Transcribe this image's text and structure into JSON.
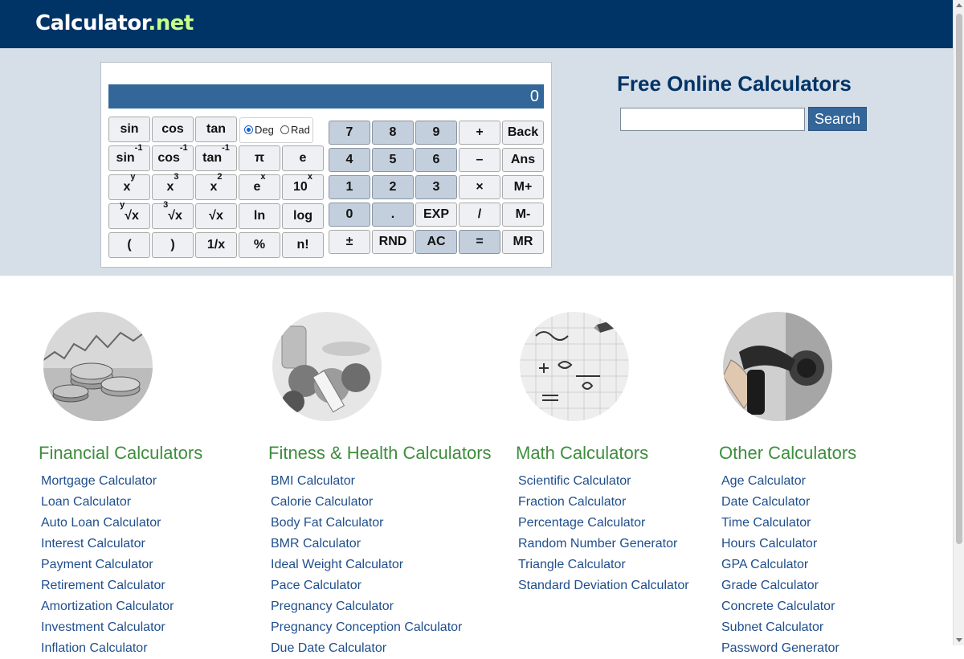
{
  "header": {
    "logo_part1": "Calculator",
    "logo_part2": ".",
    "logo_part3": "net"
  },
  "calculator": {
    "display_value": "0",
    "angle": {
      "deg_label": "Deg",
      "rad_label": "Rad",
      "selected": "Deg"
    },
    "fn_buttons": {
      "sin": "sin",
      "cos": "cos",
      "tan": "tan",
      "asin_base": "sin",
      "acos_base": "cos",
      "atan_base": "tan",
      "inverse_sup": "-1",
      "pi": "π",
      "e": "e",
      "xy_base": "x",
      "xy_sup": "y",
      "x3_base": "x",
      "x3_sup": "3",
      "x2_base": "x",
      "x2_sup": "2",
      "ex_base": "e",
      "ex_sup": "x",
      "tenx_base": "10",
      "tenx_sup": "x",
      "yroot_pre": "y",
      "yroot_base": "√x",
      "croot_pre": "3",
      "croot_base": "√x",
      "sqrt": "√x",
      "ln": "ln",
      "log": "log",
      "lparen": "(",
      "rparen": ")",
      "recip": "1/x",
      "percent": "%",
      "fact": "n!"
    },
    "keypad": {
      "n7": "7",
      "n8": "8",
      "n9": "9",
      "plus": "+",
      "back": "Back",
      "n4": "4",
      "n5": "5",
      "n6": "6",
      "minus": "–",
      "ans": "Ans",
      "n1": "1",
      "n2": "2",
      "n3": "3",
      "times": "×",
      "mplus": "M+",
      "n0": "0",
      "dot": ".",
      "exp": "EXP",
      "divide": "/",
      "mminus": "M-",
      "plusminus": "±",
      "rnd": "RND",
      "ac": "AC",
      "equals": "=",
      "mr": "MR"
    }
  },
  "search": {
    "title": "Free Online Calculators",
    "input_value": "",
    "button_label": "Search"
  },
  "categories": [
    {
      "title": "Financial Calculators",
      "image_icon": "coins-chart-image",
      "links": [
        "Mortgage Calculator",
        "Loan Calculator",
        "Auto Loan Calculator",
        "Interest Calculator",
        "Payment Calculator",
        "Retirement Calculator",
        "Amortization Calculator",
        "Investment Calculator",
        "Inflation Calculator"
      ]
    },
    {
      "title": "Fitness & Health Calculators",
      "image_icon": "fruit-measuring-tape-image",
      "links": [
        "BMI Calculator",
        "Calorie Calculator",
        "Body Fat Calculator",
        "BMR Calculator",
        "Ideal Weight Calculator",
        "Pace Calculator",
        "Pregnancy Calculator",
        "Pregnancy Conception Calculator",
        "Due Date Calculator"
      ]
    },
    {
      "title": "Math Calculators",
      "image_icon": "math-formula-pen-image",
      "links": [
        "Scientific Calculator",
        "Fraction Calculator",
        "Percentage Calculator",
        "Random Number Generator",
        "Triangle Calculator",
        "Standard Deviation Calculator"
      ]
    },
    {
      "title": "Other Calculators",
      "image_icon": "fuel-pump-image",
      "links": [
        "Age Calculator",
        "Date Calculator",
        "Time Calculator",
        "Hours Calculator",
        "GPA Calculator",
        "Grade Calculator",
        "Concrete Calculator",
        "Subnet Calculator",
        "Password Generator"
      ]
    }
  ]
}
